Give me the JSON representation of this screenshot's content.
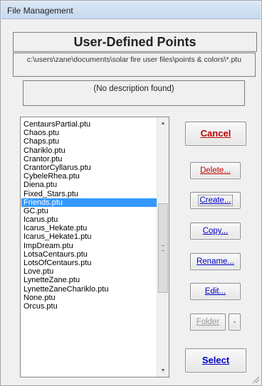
{
  "window": {
    "title": "File Management"
  },
  "header": {
    "title": "User-Defined Points"
  },
  "path": "c:\\users\\zane\\documents\\solar fire user files\\points & colors\\*.ptu",
  "description": "(No description found)",
  "files": [
    "CentaursPartial.ptu",
    "Chaos.ptu",
    "Chaps.ptu",
    "Chariklo.ptu",
    "Crantor.ptu",
    "CrantorCyllarus.ptu",
    "CybeleRhea.ptu",
    "Diena.ptu",
    "Fixed_Stars.ptu",
    "Friends.ptu",
    "GC.ptu",
    "Icarus.ptu",
    "Icarus_Hekate.ptu",
    "Icarus_Hekate1.ptu",
    "ImpDream.ptu",
    "LotsaCentaurs.ptu",
    "LotsOfCentaurs.ptu",
    "Love.ptu",
    "LynetteZane.ptu",
    "LynetteZaneChariklo.ptu",
    "None.ptu",
    "Orcus.ptu"
  ],
  "selected_file": "Friends.ptu",
  "buttons": {
    "cancel": "Cancel",
    "delete": "Delete...",
    "create": "Create...",
    "copy": "Copy...",
    "rename": "Rename...",
    "edit": "Edit...",
    "folder": "Folder",
    "select": "Select"
  },
  "colors": {
    "cancel_text": "#c00000",
    "delete_text": "#c00000",
    "action_text": "#0000c8",
    "selection": "#3399ff"
  },
  "icons": {
    "scroll_up": "scroll-up-arrow-icon",
    "scroll_down": "scroll-down-arrow-icon",
    "folder_menu": "small-square-icon"
  }
}
